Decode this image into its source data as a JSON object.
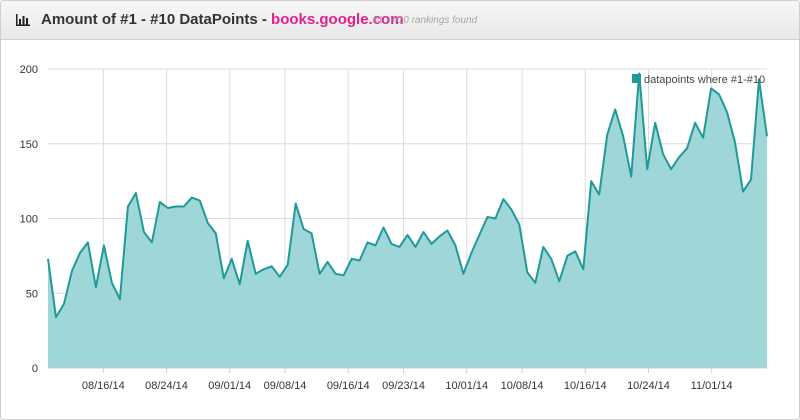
{
  "header": {
    "title_prefix": "Amount of #1 - #10 DataPoints -",
    "domain": "books.google.com",
    "subtitle": "- #1 - #10 rankings found",
    "icon": "bar-chart-icon"
  },
  "colors": {
    "accent": "#e0208e",
    "area_fill": "#9fd6d7",
    "line": "#1f9a9a"
  },
  "chart_data": {
    "type": "area",
    "x_start": "08/09/14",
    "x_end": "11/08/14",
    "xlabel": "",
    "ylabel": "",
    "ylim": [
      0,
      200
    ],
    "y_ticks": [
      0,
      50,
      100,
      150,
      200
    ],
    "x_ticks": [
      "08/16/14",
      "08/24/14",
      "09/01/14",
      "09/08/14",
      "09/16/14",
      "09/23/14",
      "10/01/14",
      "10/08/14",
      "10/16/14",
      "10/24/14",
      "11/01/14"
    ],
    "grid": true,
    "legend_position": "top-right",
    "series": [
      {
        "name": "datapoints where #1-#10",
        "values": [
          73,
          34,
          43,
          65,
          77,
          84,
          54,
          82,
          57,
          46,
          108,
          117,
          91,
          84,
          111,
          107,
          108,
          108,
          114,
          112,
          97,
          90,
          60,
          73,
          56,
          85,
          63,
          66,
          68,
          61,
          69,
          110,
          93,
          90,
          63,
          71,
          63,
          62,
          73,
          72,
          84,
          82,
          94,
          83,
          81,
          89,
          81,
          91,
          83,
          88,
          92,
          82,
          63,
          77,
          89,
          101,
          100,
          113,
          106,
          96,
          64,
          57,
          81,
          73,
          58,
          75,
          78,
          66,
          125,
          116,
          156,
          173,
          155,
          128,
          197,
          133,
          164,
          143,
          133,
          141,
          147,
          164,
          154,
          187,
          183,
          171,
          151,
          118,
          126,
          193,
          155
        ]
      }
    ]
  }
}
